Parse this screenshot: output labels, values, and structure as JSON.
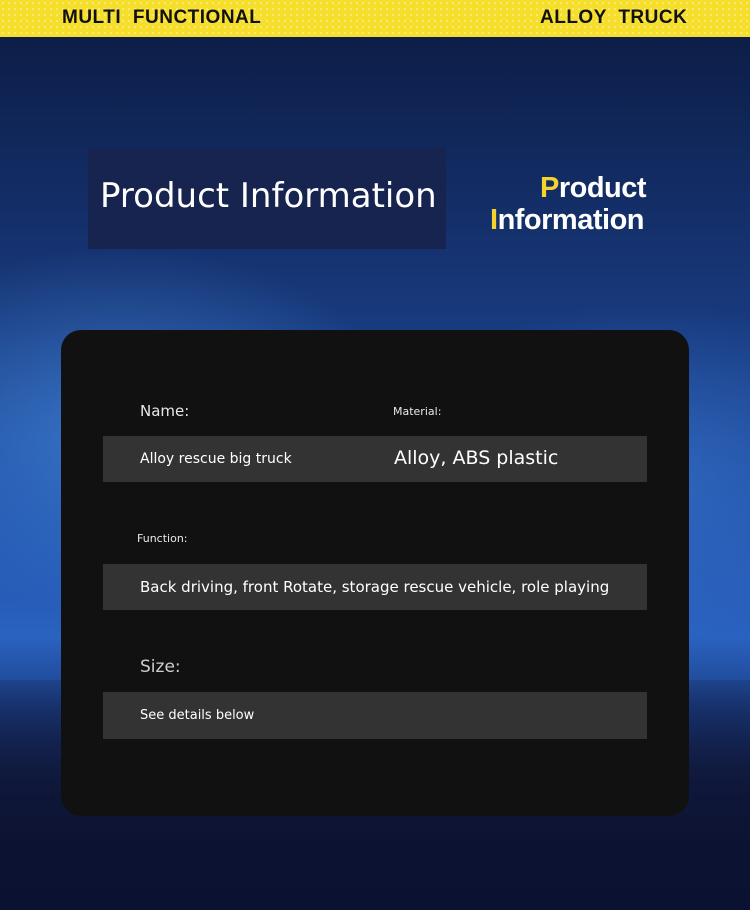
{
  "banner": {
    "left": "MULTI FUNCTIONAL",
    "right": "ALLOY TRUCK",
    "color": "#f6de2c"
  },
  "title_box": {
    "text": "Product Information"
  },
  "logo_title": {
    "line1_initial": "P",
    "line1_rest": "roduct",
    "line2_initial": "I",
    "line2_rest": "nformation",
    "accent_color": "#f6d22c"
  },
  "product_info": {
    "name_label": "Name:",
    "name_value": "Alloy rescue big truck",
    "material_label": "Material:",
    "material_value": "Alloy, ABS plastic",
    "function_label": "Function:",
    "function_value": "Back driving, front Rotate, storage rescue vehicle, role playing",
    "size_label": "Size:",
    "size_value": "See details below"
  }
}
